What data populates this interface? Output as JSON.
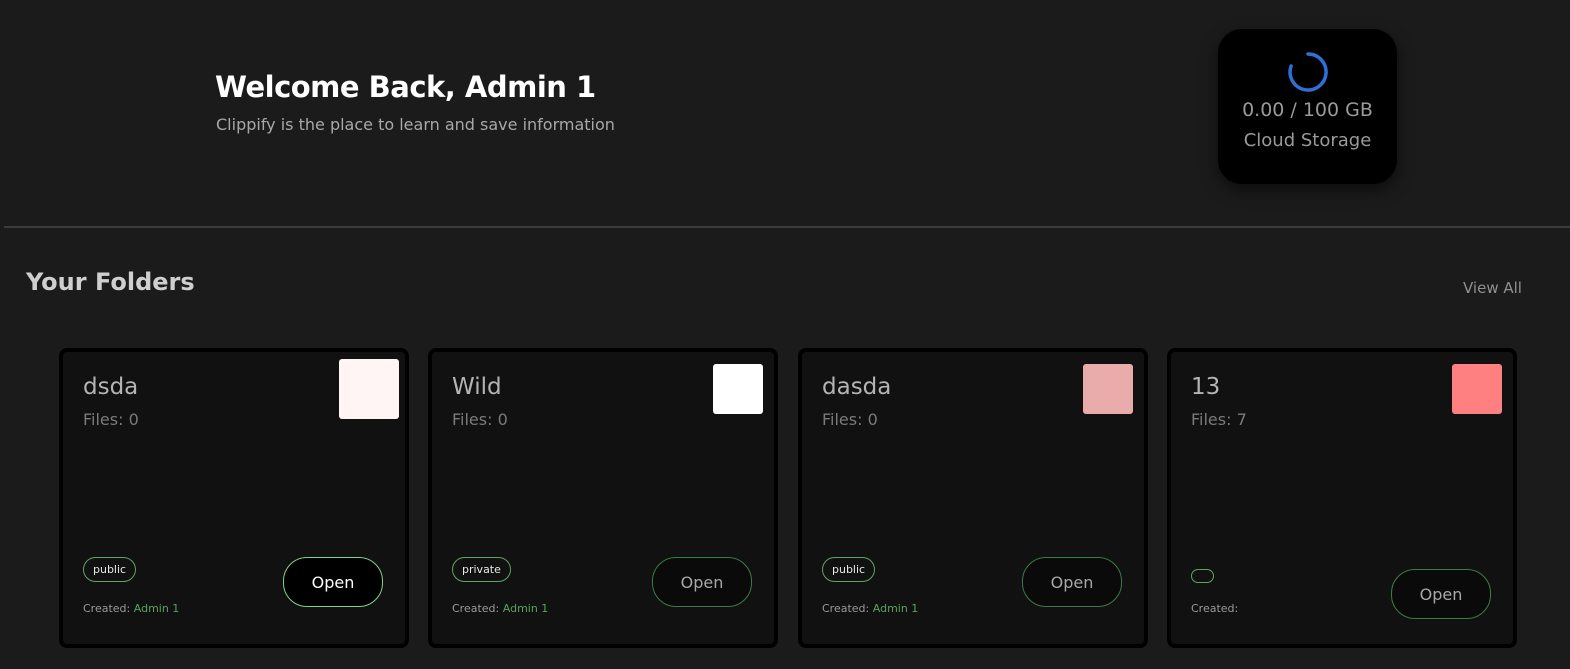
{
  "header": {
    "title": "Welcome Back, Admin 1",
    "subtitle": "Clippify is the place to learn and save information"
  },
  "storage": {
    "used": "0.00",
    "total": "100 GB",
    "amount_label": "0.00 / 100 GB",
    "label": "Cloud Storage",
    "spinner_color": "#2f6fd6"
  },
  "folders_section": {
    "title": "Your Folders",
    "view_all_label": "View All"
  },
  "folders": [
    {
      "name": "dsda",
      "files_label": "Files: 0",
      "color": "#fff5f5",
      "visibility": "public",
      "created_label": "Created:",
      "created_by": "Admin 1",
      "open_label": "Open"
    },
    {
      "name": "Wild",
      "files_label": "Files: 0",
      "color": "#ffffff",
      "visibility": "private",
      "created_label": "Created:",
      "created_by": "Admin 1",
      "open_label": "Open"
    },
    {
      "name": "dasda",
      "files_label": "Files: 0",
      "color": "#eaabab",
      "visibility": "public",
      "created_label": "Created:",
      "created_by": "Admin 1",
      "open_label": "Open"
    },
    {
      "name": "13",
      "files_label": "Files: 7",
      "color": "#ff8080",
      "visibility": "",
      "created_label": "Created:",
      "created_by": "",
      "open_label": "Open"
    }
  ],
  "colors": {
    "background": "#1b1b1b",
    "card_background": "#111111",
    "accent_green": "#58a35f",
    "badge_border": "#5fa26a"
  }
}
